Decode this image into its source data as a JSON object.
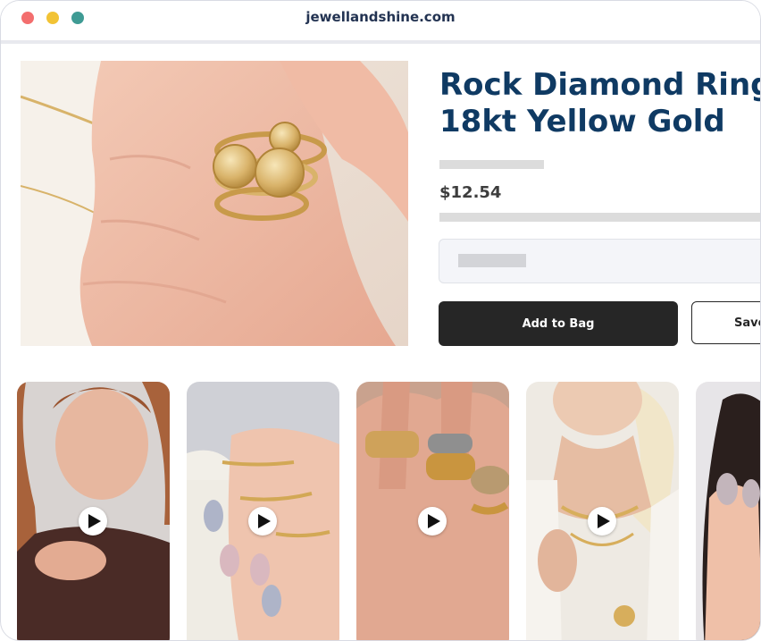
{
  "browser": {
    "url": "jewellandshine.com"
  },
  "product": {
    "title_line1": "Rock Diamond Ring",
    "title_line2": "18kt Yellow Gold",
    "price": "$12.54"
  },
  "actions": {
    "add_to_bag": "Add to Bag",
    "save": "Save"
  },
  "videos": [
    {
      "id": "video-1",
      "icon": "play-icon"
    },
    {
      "id": "video-2",
      "icon": "play-icon"
    },
    {
      "id": "video-3",
      "icon": "play-icon"
    },
    {
      "id": "video-4",
      "icon": "play-icon"
    },
    {
      "id": "video-5",
      "icon": "play-icon"
    }
  ],
  "colors": {
    "title": "#0f3a63",
    "primary_button": "#262626",
    "traffic_red": "#f36e6e",
    "traffic_yellow": "#f2c335",
    "traffic_green": "#3f9b94"
  }
}
